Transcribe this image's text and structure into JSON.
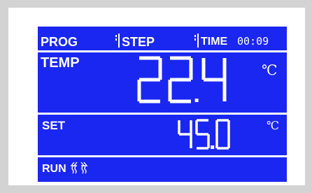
{
  "header": {
    "prog_label": "PROG",
    "step_label": "STEP",
    "time_label": "TIME",
    "time_value": "00:09"
  },
  "temp": {
    "label": "TEMP",
    "value": "22.4",
    "unit": "℃"
  },
  "set": {
    "label": "SET",
    "value": "45.0",
    "unit": "℃"
  },
  "status": {
    "run_label": "RUN",
    "icon": "heating-waves-icon"
  },
  "colors": {
    "lcd_background": "#1a27f0",
    "lcd_foreground": "#ffffff",
    "bezel": "#ffffff",
    "frame": "#d3d3d3"
  }
}
